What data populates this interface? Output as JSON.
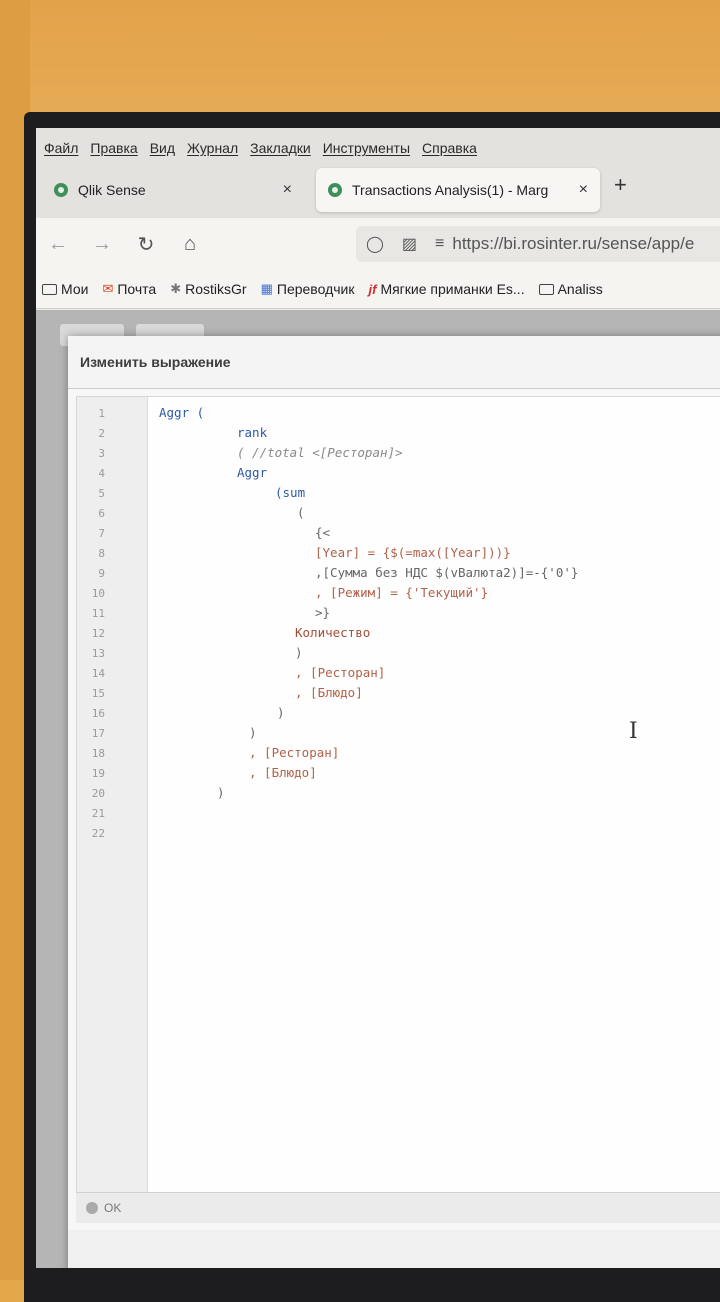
{
  "menubar": {
    "items": [
      "Файл",
      "Правка",
      "Вид",
      "Журнал",
      "Закладки",
      "Инструменты",
      "Справка"
    ]
  },
  "tabs": [
    {
      "label": "Qlik Sense",
      "close": "×",
      "icon": "qlik-icon"
    },
    {
      "label": "Transactions Analysis(1) - Marg",
      "close": "×",
      "icon": "qlik-icon"
    }
  ],
  "newtab": "+",
  "nav": {
    "url": "https://bi.rosinter.ru/sense/app/e"
  },
  "bookmarks": [
    {
      "label": "Мои",
      "icon": "folder-icon"
    },
    {
      "label": "Почта",
      "icon": "mail-icon"
    },
    {
      "label": "RostiksGr",
      "icon": "bookmark-icon"
    },
    {
      "label": "Переводчик",
      "icon": "translate-icon"
    },
    {
      "label": "Мягкие приманки Es...",
      "icon": "bookmark-icon"
    },
    {
      "label": "Analiss",
      "icon": "folder-icon"
    }
  ],
  "dialog": {
    "title": "Изменить выражение",
    "status": "OK"
  },
  "editor": {
    "line_numbers": [
      "1",
      "2",
      "3",
      "4",
      "5",
      "6",
      "7",
      "8",
      "9",
      "10",
      "11",
      "12",
      "13",
      "14",
      "15",
      "16",
      "17",
      "18",
      "19",
      "20",
      "21",
      "22"
    ],
    "lines": [
      "Aggr (",
      "rank",
      "( //total <[Ресторан]>",
      "Aggr",
      "(sum",
      "(",
      "{<",
      "[Year] = {$(=max([Year]))}",
      ",[Сумма без НДС $(vВалюта2)]=-{'0'}",
      ", [Режим] = {'Текущий'}",
      ">}",
      "Количество",
      ")",
      ", [Ресторан]",
      ", [Блюдо]",
      ")",
      ")",
      ", [Ресторан]",
      ", [Блюдо]",
      ")",
      "",
      ""
    ]
  }
}
